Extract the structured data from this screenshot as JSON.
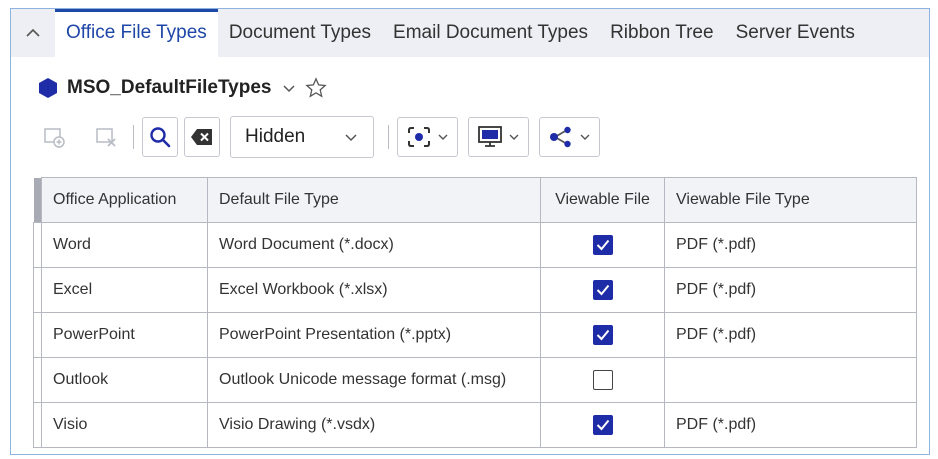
{
  "tabs": [
    {
      "label": "Office File Types",
      "active": true
    },
    {
      "label": "Document Types",
      "active": false
    },
    {
      "label": "Email Document Types",
      "active": false
    },
    {
      "label": "Ribbon Tree",
      "active": false
    },
    {
      "label": "Server Events",
      "active": false
    }
  ],
  "header": {
    "title": "MSO_DefaultFileTypes"
  },
  "toolbar": {
    "filter_value": "Hidden"
  },
  "table": {
    "columns": [
      "Office Application",
      "Default File Type",
      "Viewable File",
      "Viewable File Type"
    ],
    "rows": [
      {
        "app": "Word",
        "type": "Word Document (*.docx)",
        "viewable": true,
        "viewable_type": "PDF (*.pdf)"
      },
      {
        "app": "Excel",
        "type": "Excel Workbook (*.xlsx)",
        "viewable": true,
        "viewable_type": "PDF (*.pdf)"
      },
      {
        "app": "PowerPoint",
        "type": "PowerPoint Presentation (*.pptx)",
        "viewable": true,
        "viewable_type": "PDF (*.pdf)"
      },
      {
        "app": "Outlook",
        "type": "Outlook Unicode message format (.msg)",
        "viewable": false,
        "viewable_type": ""
      },
      {
        "app": "Visio",
        "type": "Visio Drawing (*.vsdx)",
        "viewable": true,
        "viewable_type": "PDF (*.pdf)"
      }
    ]
  },
  "colors": {
    "accent": "#1f47a8",
    "checkbox": "#1f2ca8",
    "tabbar_bg": "#eeeff4"
  },
  "icons": [
    "chevron-up-icon",
    "hexagon-icon",
    "chevron-down-icon",
    "star-icon",
    "add-item-icon",
    "remove-item-icon",
    "search-icon",
    "clear-icon",
    "focus-icon",
    "monitor-icon",
    "share-icon"
  ]
}
